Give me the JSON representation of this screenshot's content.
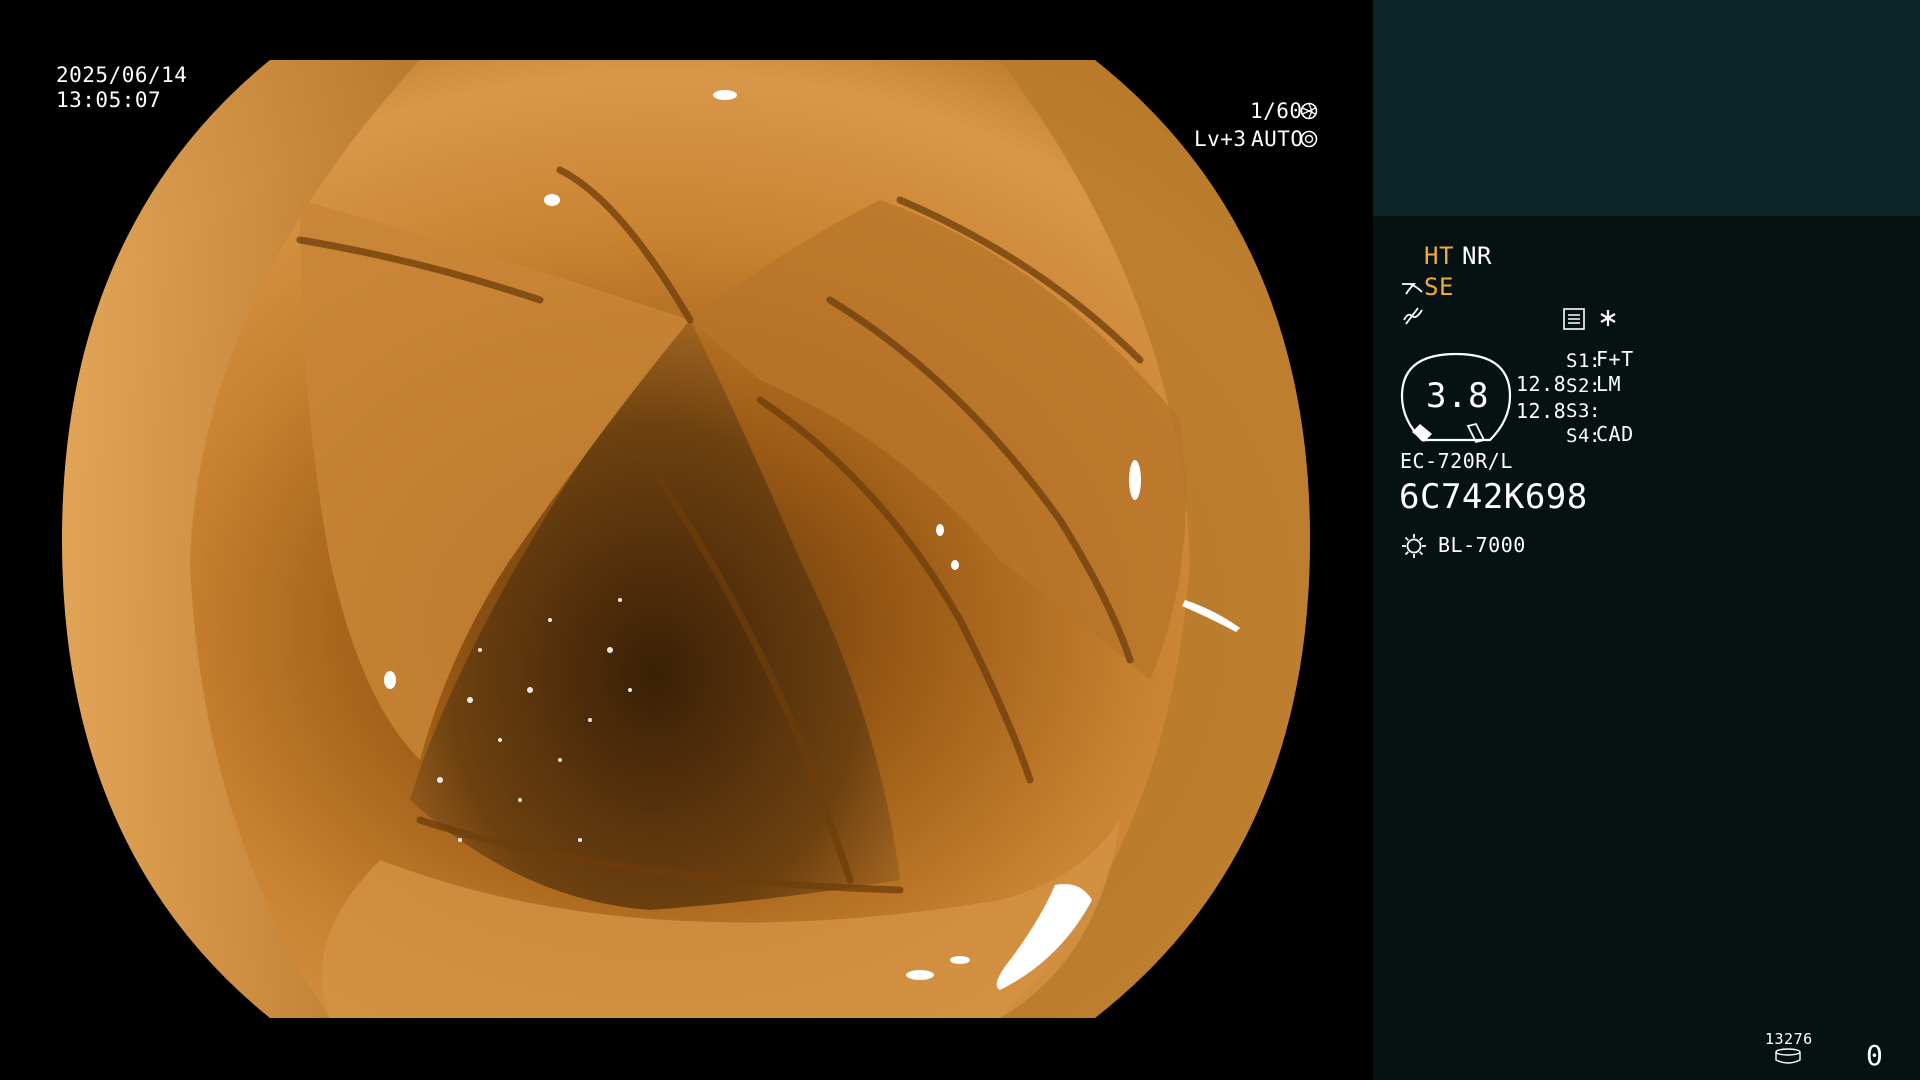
{
  "overlay": {
    "date": "2025/06/14",
    "time": "13:05:07",
    "shutter": "1/60",
    "level": "Lv+3",
    "exposure_mode": "AUTO"
  },
  "panel": {
    "ht_label": "HT",
    "nr_label": "NR",
    "se_label": "SE",
    "gauge_value": "3.8",
    "value_1": "12.8",
    "value_2": "12.8",
    "switches": [
      {
        "key": "S1",
        "value": "F+T"
      },
      {
        "key": "S2",
        "value": "LM"
      },
      {
        "key": "S3",
        "value": ""
      },
      {
        "key": "S4",
        "value": "CAD"
      }
    ],
    "scope_model": "EC-720R/L",
    "serial": "6C742K698",
    "light_source": "BL-7000",
    "counter_small": "13276",
    "counter_big": "0"
  },
  "colors": {
    "accent_amber": "#f2a93b",
    "panel_top": "#0b2627",
    "panel_bottom": "#061212"
  },
  "icons": [
    "aperture-icon",
    "iris-icon",
    "scope-icon",
    "waveform-icon",
    "menu-icon",
    "asterisk-icon",
    "light-source-icon",
    "storage-icon"
  ]
}
